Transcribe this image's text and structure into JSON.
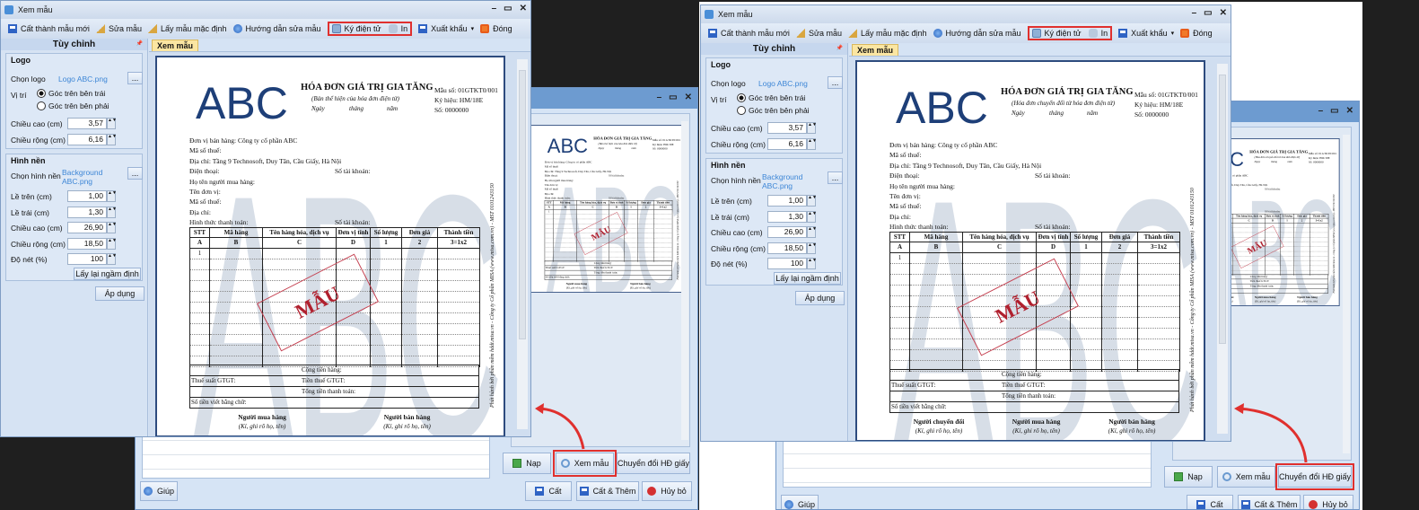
{
  "app": {
    "window_title": "Xem mẫu",
    "window_controls": {
      "minimize": "–",
      "maximize": "▭",
      "close": "✕"
    },
    "toolbar": {
      "save_new": "Cất thành mẫu mới",
      "edit": "Sửa mẫu",
      "default": "Lấy mẫu mặc định",
      "guide": "Hướng dẫn sửa mẫu",
      "sign": "Ký điện tử",
      "print": "In",
      "export": "Xuất khẩu",
      "export_arrow": "▾",
      "close": "Đóng"
    },
    "sidebar": {
      "title": "Tùy chỉnh",
      "pin": "📌",
      "logo_group": {
        "legend": "Logo",
        "choose_label": "Chọn logo",
        "file": "Logo ABC.png",
        "browse": "...",
        "position_label": "Vị trí",
        "positions": [
          "Góc trên bên trái",
          "Góc trên bên phải"
        ],
        "selected_position": 0,
        "height_label": "Chiều cao (cm)",
        "height": "3,57",
        "width_label": "Chiều rộng (cm)",
        "width": "6,16"
      },
      "bg_group": {
        "legend": "Hình nền",
        "choose_label": "Chọn hình nền",
        "file": "Background ABC.png",
        "browse": "...",
        "fields": [
          {
            "label": "Lề trên (cm)",
            "value": "1,00"
          },
          {
            "label": "Lề trái (cm)",
            "value": "1,30"
          },
          {
            "label": "Chiều cao (cm)",
            "value": "26,90"
          },
          {
            "label": "Chiều rộng (cm)",
            "value": "18,50"
          },
          {
            "label": "Độ nét (%)",
            "value": "100"
          }
        ],
        "reset": "Lấy lại ngầm định"
      },
      "apply": "Áp dụng"
    },
    "tab": "Xem mẫu",
    "invoice": {
      "logo": "ABC",
      "watermark": "ABC",
      "stamp": "MẪU",
      "title": "HÓA ĐƠN GIÁ TRỊ GIA TĂNG",
      "date_line": [
        "Ngày",
        "tháng",
        "năm"
      ],
      "meta": [
        "Mẫu số:  01GTKT0/001",
        "Ký hiệu:  HM/18E",
        "Số:  0000000"
      ],
      "fields": [
        {
          "text": "Đơn vị bán hàng:    Công ty cổ phần ABC",
          "right": ""
        },
        {
          "text": "Mã số thuế:",
          "right": ""
        },
        {
          "text": "Địa chỉ:   Tầng 9 Technosoft, Duy Tân, Cầu Giấy, Hà Nội",
          "right": ""
        },
        {
          "text": "Điện thoại:",
          "right": "Số tài khoản:"
        },
        {
          "text": "Họ tên người mua hàng:",
          "right": ""
        },
        {
          "text": "Tên đơn vị:",
          "right": ""
        },
        {
          "text": "Mã số thuế:",
          "right": ""
        },
        {
          "text": "Địa chỉ:",
          "right": ""
        },
        {
          "text": "Hình thức thanh toán:",
          "right": "Số tài khoản:"
        }
      ],
      "columns": [
        "STT",
        "Mã hàng",
        "Tên hàng hóa, dịch vụ",
        "Đơn vị tính",
        "Số lượng",
        "Đơn giá",
        "Thành tiền"
      ],
      "column_codes": [
        "A",
        "B",
        "C",
        "D",
        "1",
        "2",
        "3=1x2"
      ],
      "rows": [
        [
          "1",
          "",
          "",
          "",
          "",
          "",
          ""
        ],
        [
          "",
          "",
          "",
          "",
          "",
          "",
          ""
        ],
        [
          "",
          "",
          "",
          "",
          "",
          "",
          ""
        ],
        [
          "",
          "",
          "",
          "",
          "",
          "",
          ""
        ],
        [
          "",
          "",
          "",
          "",
          "",
          "",
          ""
        ],
        [
          "",
          "",
          "",
          "",
          "",
          "",
          ""
        ],
        [
          "",
          "",
          "",
          "",
          "",
          "",
          ""
        ],
        [
          "",
          "",
          "",
          "",
          "",
          "",
          ""
        ],
        [
          "",
          "",
          "",
          "",
          "",
          "",
          ""
        ],
        [
          "",
          "",
          "",
          "",
          "",
          "",
          ""
        ],
        [
          "",
          "",
          "",
          "",
          "",
          "",
          ""
        ]
      ],
      "totals": [
        {
          "left": "",
          "center": "Cộng tiền hàng:"
        },
        {
          "left": "Thuế suất GTGT:",
          "center": "Tiền thuế GTGT:"
        },
        {
          "left": "",
          "center": "Tổng tiền thanh toán:"
        },
        {
          "left": "Số tiền viết bằng chữ:",
          "center": ""
        }
      ],
      "side_note": "Phát hành bởi phần mềm hddt.misa.vn - Công ty Cổ phần MISA (www.misa.com.vn) - MST 0101243150"
    },
    "back_window": {
      "load": "Nạp",
      "preview": "Xem mẫu",
      "convert": "Chuyển đổi HĐ giấy",
      "help": "Giúp",
      "save": "Cất",
      "save_add": "Cất & Thêm",
      "cancel": "Hủy bỏ"
    }
  },
  "panels": [
    {
      "invoice_subtitle": "(Bản thể hiện của hóa đơn điện tử)",
      "signatures": [
        {
          "title": "Người mua hàng",
          "note": "(Kí, ghi rõ họ, tên)"
        },
        {
          "title": "Người bán hàng",
          "note": "(Kí, ghi rõ họ, tên)"
        }
      ],
      "highlighted_toolbar": [
        "sign",
        "print"
      ],
      "highlighted_button": "preview"
    },
    {
      "invoice_subtitle": "(Hóa đơn chuyển đổi từ hóa đơn điện tử)",
      "signatures": [
        {
          "title": "Người chuyển đổi",
          "note": "(Kí, ghi rõ họ, tên)"
        },
        {
          "title": "Người mua hàng",
          "note": "(Kí, ghi rõ họ, tên)"
        },
        {
          "title": "Người bán hàng",
          "note": "(Kí, ghi rõ họ, tên)"
        }
      ],
      "highlighted_toolbar": [
        "sign",
        "print"
      ],
      "highlighted_button": "convert"
    }
  ],
  "colors": {
    "highlight": "#e0302e",
    "logo": "#1e3f78",
    "stamp": "#b0202e",
    "window": "#d5e3f4",
    "title_bar_back": "#6d9bd0"
  }
}
